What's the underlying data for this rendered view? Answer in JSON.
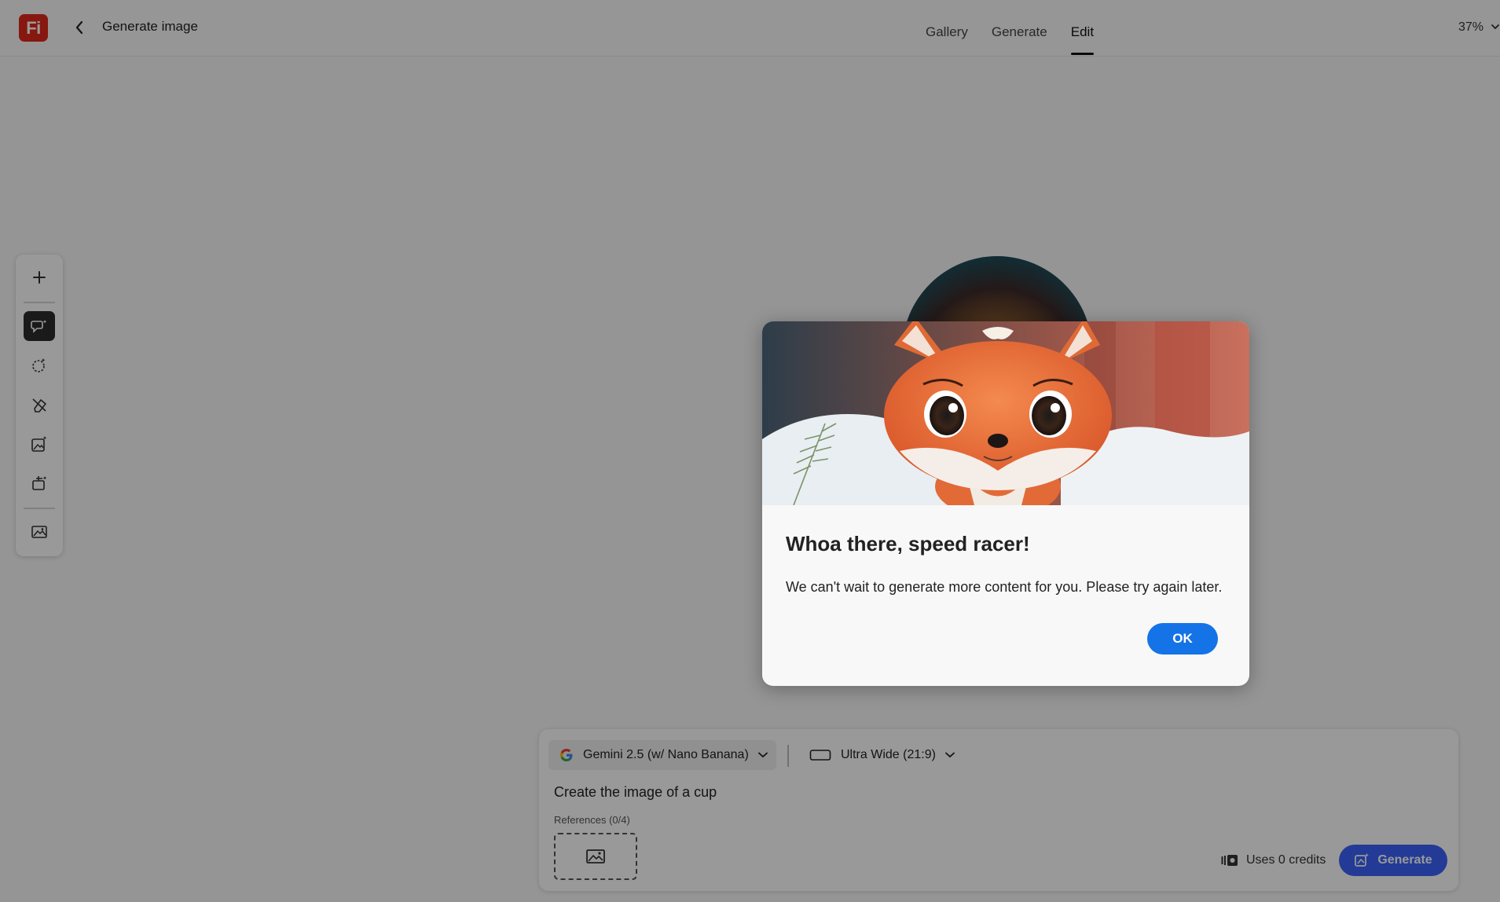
{
  "app": {
    "logo_text": "Fi",
    "page_title": "Generate image",
    "zoom": "37%",
    "brand_color": "#e0291b"
  },
  "tabs": [
    {
      "label": "Gallery",
      "active": false
    },
    {
      "label": "Generate",
      "active": false
    },
    {
      "label": "Edit",
      "active": true
    }
  ],
  "toolbar": {
    "items": [
      {
        "icon": "plus-icon"
      },
      {
        "icon": "prompt-edit-icon",
        "active": true
      },
      {
        "icon": "magic-select-icon"
      },
      {
        "icon": "remove-object-icon"
      },
      {
        "icon": "generative-fill-icon"
      },
      {
        "icon": "expand-icon"
      },
      {
        "icon": "image-icon"
      }
    ]
  },
  "prompt_panel": {
    "model": "Gemini 2.5 (w/ Nano Banana)",
    "aspect_ratio": "Ultra Wide (21:9)",
    "prompt": "Create the image of a cup",
    "references_label": "References (0/4)",
    "credits_label": "Uses 0 credits",
    "generate_label": "Generate",
    "generate_color": "#3b63fb"
  },
  "modal": {
    "title": "Whoa there, speed racer!",
    "body": "We can't wait to generate more content for you. Please try again later.",
    "ok_label": "OK",
    "ok_color": "#1473e6"
  }
}
